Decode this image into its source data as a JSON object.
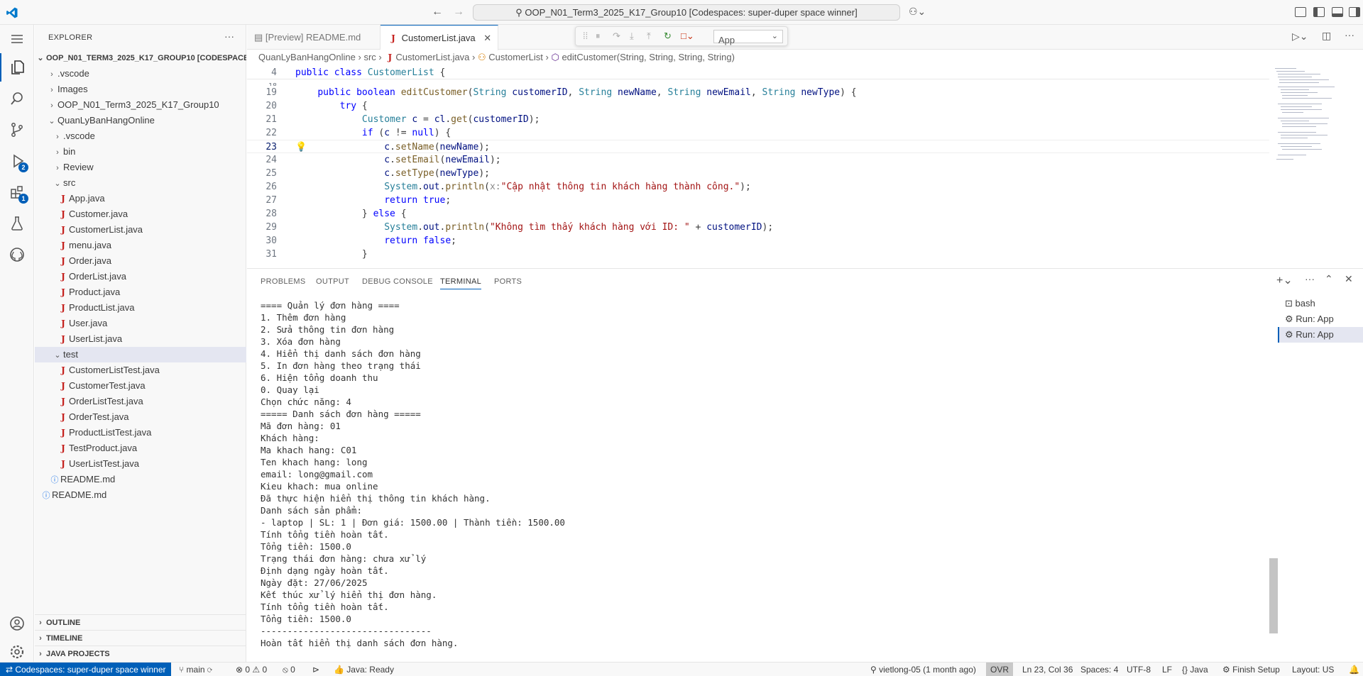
{
  "titlebar": {
    "command_center": "OOP_N01_Term3_2025_K17_Group10 [Codespaces: super-duper space winner]"
  },
  "activity": {
    "run_debug_badge": "2",
    "extensions_badge": "1"
  },
  "explorer": {
    "header": "EXPLORER",
    "root": "OOP_N01_TERM3_2025_K17_GROUP10 [CODESPACE...",
    "items": [
      {
        "label": ".vscode"
      },
      {
        "label": "Images"
      },
      {
        "label": "OOP_N01_Term3_2025_K17_Group10"
      },
      {
        "label": "QuanLyBanHangOnline"
      },
      {
        "label": ".vscode"
      },
      {
        "label": "bin"
      },
      {
        "label": "Review"
      },
      {
        "label": "src"
      },
      {
        "label": "App.java"
      },
      {
        "label": "Customer.java"
      },
      {
        "label": "CustomerList.java"
      },
      {
        "label": "menu.java"
      },
      {
        "label": "Order.java"
      },
      {
        "label": "OrderList.java"
      },
      {
        "label": "Product.java"
      },
      {
        "label": "ProductList.java"
      },
      {
        "label": "User.java"
      },
      {
        "label": "UserList.java"
      },
      {
        "label": "test"
      },
      {
        "label": "CustomerListTest.java"
      },
      {
        "label": "CustomerTest.java"
      },
      {
        "label": "OrderListTest.java"
      },
      {
        "label": "OrderTest.java"
      },
      {
        "label": "ProductListTest.java"
      },
      {
        "label": "TestProduct.java"
      },
      {
        "label": "UserListTest.java"
      },
      {
        "label": "README.md"
      },
      {
        "label": "README.md"
      }
    ],
    "sections": {
      "outline": "OUTLINE",
      "timeline": "TIMELINE",
      "java_projects": "JAVA PROJECTS"
    }
  },
  "tabs": [
    {
      "label": "[Preview] README.md"
    },
    {
      "label": "CustomerList.java"
    }
  ],
  "debug": {
    "config": "App"
  },
  "breadcrumb": [
    "QuanLyBanHangOnline",
    "src",
    "CustomerList.java",
    "CustomerList",
    "editCustomer(String, String, String, String)"
  ],
  "editor": {
    "sticky": {
      "ln": "4",
      "code": "public class CustomerList {"
    },
    "lines": [
      {
        "ln": "18"
      },
      {
        "ln": "19"
      },
      {
        "ln": "20"
      },
      {
        "ln": "21"
      },
      {
        "ln": "22"
      },
      {
        "ln": "23"
      },
      {
        "ln": "24"
      },
      {
        "ln": "25"
      },
      {
        "ln": "26"
      },
      {
        "ln": "27"
      },
      {
        "ln": "28"
      },
      {
        "ln": "29"
      },
      {
        "ln": "30"
      },
      {
        "ln": "31"
      }
    ]
  },
  "panel": {
    "tabs": [
      "PROBLEMS",
      "OUTPUT",
      "DEBUG CONSOLE",
      "TERMINAL",
      "PORTS"
    ],
    "terminal_lines": [
      "==== Quản lý đơn hàng ====",
      "1. Thêm đơn hàng",
      "2. Sửa thông tin đơn hàng",
      "3. Xóa đơn hàng",
      "4. Hiển thị danh sách đơn hàng",
      "5. In đơn hàng theo trạng thái",
      "6. Hiện tổng doanh thu",
      "0. Quay lại",
      "Chọn chức năng: 4",
      "===== Danh sách đơn hàng =====",
      "Mã đơn hàng: 01",
      "Khách hàng:",
      "Ma khach hang: C01",
      "Ten khach hang: long",
      "email: long@gmail.com",
      "Kieu khach: mua online",
      "Đã thực hiện hiển thị thông tin khách hàng.",
      "Danh sách sản phẩm:",
      "- laptop | SL: 1 | Đơn giá: 1500.00 | Thành tiền: 1500.00",
      "Tính tổng tiền hoàn tất.",
      "Tổng tiền: 1500.0",
      "Trạng thái đơn hàng: chưa xử lý",
      "Định dạng ngày hoàn tất.",
      "Ngày đặt: 27/06/2025",
      "Kết thúc xử lý hiển thị đơn hàng.",
      "Tính tổng tiền hoàn tất.",
      "Tổng tiền: 1500.0",
      "--------------------------------",
      "Hoàn tất hiển thị danh sách đơn hàng."
    ],
    "terminals": [
      "bash",
      "Run: App",
      "Run: App"
    ]
  },
  "statusbar": {
    "remote": "Codespaces: super-duper space winner",
    "branch": "main",
    "errors": "0",
    "warnings": "0",
    "ports": "0",
    "java": "Java: Ready",
    "blame": "vietlong-05 (1 month ago)",
    "ovr": "OVR",
    "position": "Ln 23, Col 36",
    "spaces": "Spaces: 4",
    "encoding": "UTF-8",
    "eol": "LF",
    "language": "Java",
    "finish_setup": "Finish Setup",
    "layout": "Layout: US"
  },
  "colors": {
    "accent": "#005fb8",
    "java_icon": "#c5221f",
    "keyword": "#0000ff",
    "string": "#a31515",
    "type": "#267f99"
  }
}
